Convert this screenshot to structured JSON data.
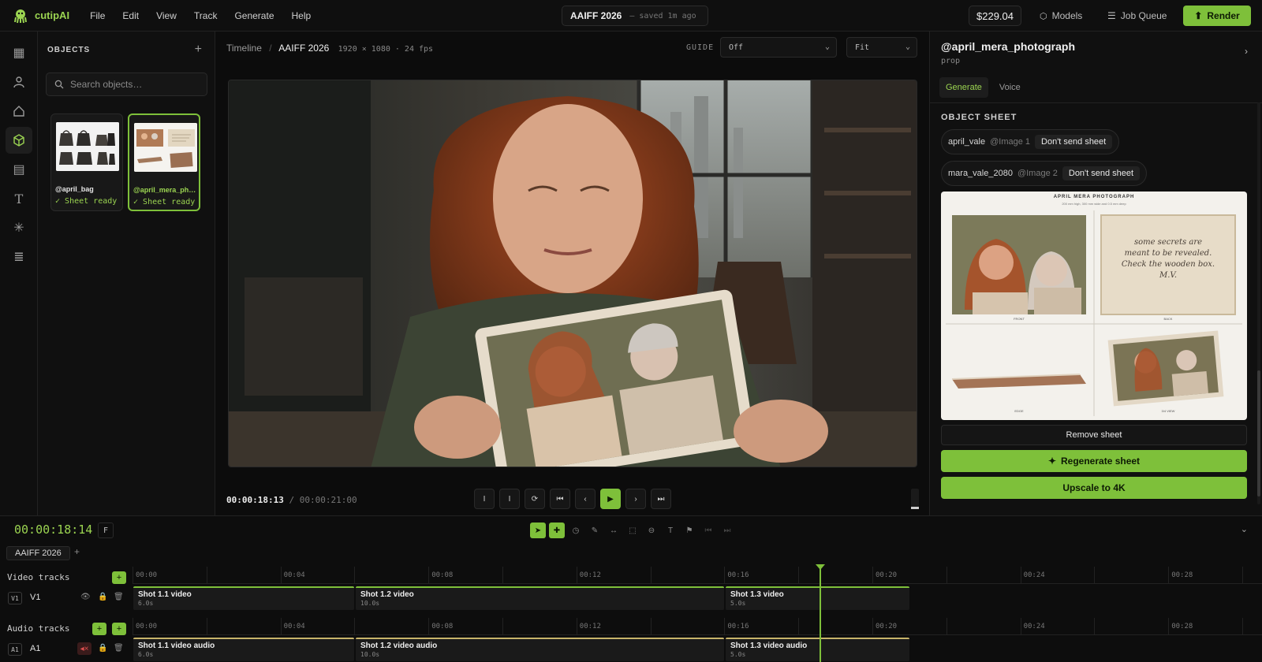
{
  "app": {
    "name": "cutipAI"
  },
  "menu": [
    "File",
    "Edit",
    "View",
    "Track",
    "Generate",
    "Help"
  ],
  "doc": {
    "title": "AAIFF 2026",
    "saved": "— saved 1m ago"
  },
  "topright": {
    "price": "$229.04",
    "models": "Models",
    "job_queue": "Job Queue",
    "render": "Render"
  },
  "objects": {
    "heading": "OBJECTS",
    "search_placeholder": "Search objects…",
    "items": [
      {
        "name": "@april_bag",
        "status": "Sheet ready"
      },
      {
        "name": "@april_mera_ph…",
        "status": "Sheet ready"
      }
    ]
  },
  "preview": {
    "crumb_root": "Timeline",
    "crumb_sep": "/",
    "crumb_current": "AAIFF 2026",
    "spec": "1920 × 1080 · 24 fps",
    "guide_label": "GUIDE",
    "guide_value": "Off",
    "fit_value": "Fit",
    "timecode": "00:00:18:13",
    "timecode_sep": "/",
    "duration": "00:00:21:00"
  },
  "inspector": {
    "at": "@",
    "name": "april_mera_photograph",
    "type": "prop",
    "tabs": [
      "Generate",
      "Voice"
    ],
    "sheet_heading": "OBJECT SHEET",
    "refs": [
      {
        "name": "april_vale",
        "image": "@Image 1",
        "action": "Don't send sheet"
      },
      {
        "name": "mara_vale_2080",
        "image": "@Image 2",
        "action": "Don't send sheet"
      }
    ],
    "sheet": {
      "title": "APRIL MERA PHOTOGRAPH",
      "dims": "200 mm high, 300 mm wide and 0.5 mm deep",
      "note_l1": "some secrets are",
      "note_l2": "meant to be revealed.",
      "note_l3": "Check the wooden box.",
      "note_sig": "M.V.",
      "labels": [
        "FRONT",
        "BACK",
        "EDGE",
        "3/4 VIEW"
      ]
    },
    "remove": "Remove sheet",
    "regenerate": "Regenerate sheet",
    "upscale": "Upscale to 4K"
  },
  "timeline": {
    "clock": "00:00:18:14",
    "f_key": "F",
    "sequence": "AAIFF 2026",
    "video_tracks": "Video tracks",
    "audio_tracks": "Audio tracks",
    "ticks": [
      "00:00",
      "00:04",
      "00:08",
      "00:12",
      "00:16",
      "00:20",
      "00:24",
      "00:28"
    ],
    "v1": {
      "key": "V1",
      "name": "V1"
    },
    "a1": {
      "key": "A1",
      "name": "A1"
    },
    "video_clips": [
      {
        "label": "Shot 1.1 video",
        "dur": "6.0s"
      },
      {
        "label": "Shot 1.2 video",
        "dur": "10.0s"
      },
      {
        "label": "Shot 1.3 video",
        "dur": "5.0s"
      }
    ],
    "audio_clips": [
      {
        "label": "Shot 1.1 video audio",
        "dur": "6.0s"
      },
      {
        "label": "Shot 1.2 video audio",
        "dur": "10.0s"
      },
      {
        "label": "Shot 1.3 video audio",
        "dur": "5.0s"
      }
    ]
  },
  "colors": {
    "accent": "#7ec03a",
    "background": "#0c0c0c",
    "audio_clip": "#c7b46a"
  }
}
